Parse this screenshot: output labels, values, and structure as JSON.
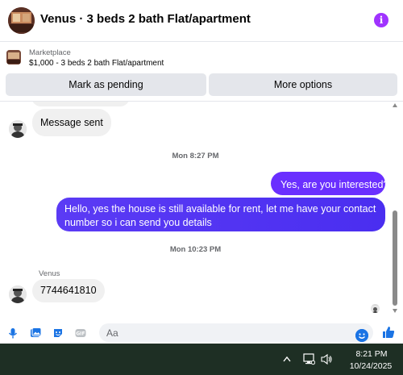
{
  "header": {
    "title": "Venus · 3 beds 2 bath Flat/apartment",
    "info_icon": "info-icon",
    "accent": "#a033ff"
  },
  "listing": {
    "label": "Marketplace",
    "subtitle": "$1,000 - 3 beds 2 bath Flat/apartment",
    "pending_button": "Mark as pending",
    "more_button": "More options"
  },
  "messages": {
    "msg1": "Message sent",
    "timestamp1": "Mon 8:27 PM",
    "out1": "Yes, are you interested?",
    "out2": "Hello, yes the house is still available for rent, let me have your contact number so i can send you details",
    "timestamp2": "Mon 10:23 PM",
    "sender": "Venus",
    "msg2": "7744641810"
  },
  "composer": {
    "placeholder": "Aa",
    "icons": [
      "microphone-icon",
      "photo-icon",
      "sticker-icon",
      "gif-icon",
      "emoji-icon",
      "thumbs-up-icon"
    ],
    "accent": "#1b74e4"
  },
  "taskbar": {
    "time": "8:21 PM",
    "date": "10/24/2025"
  }
}
